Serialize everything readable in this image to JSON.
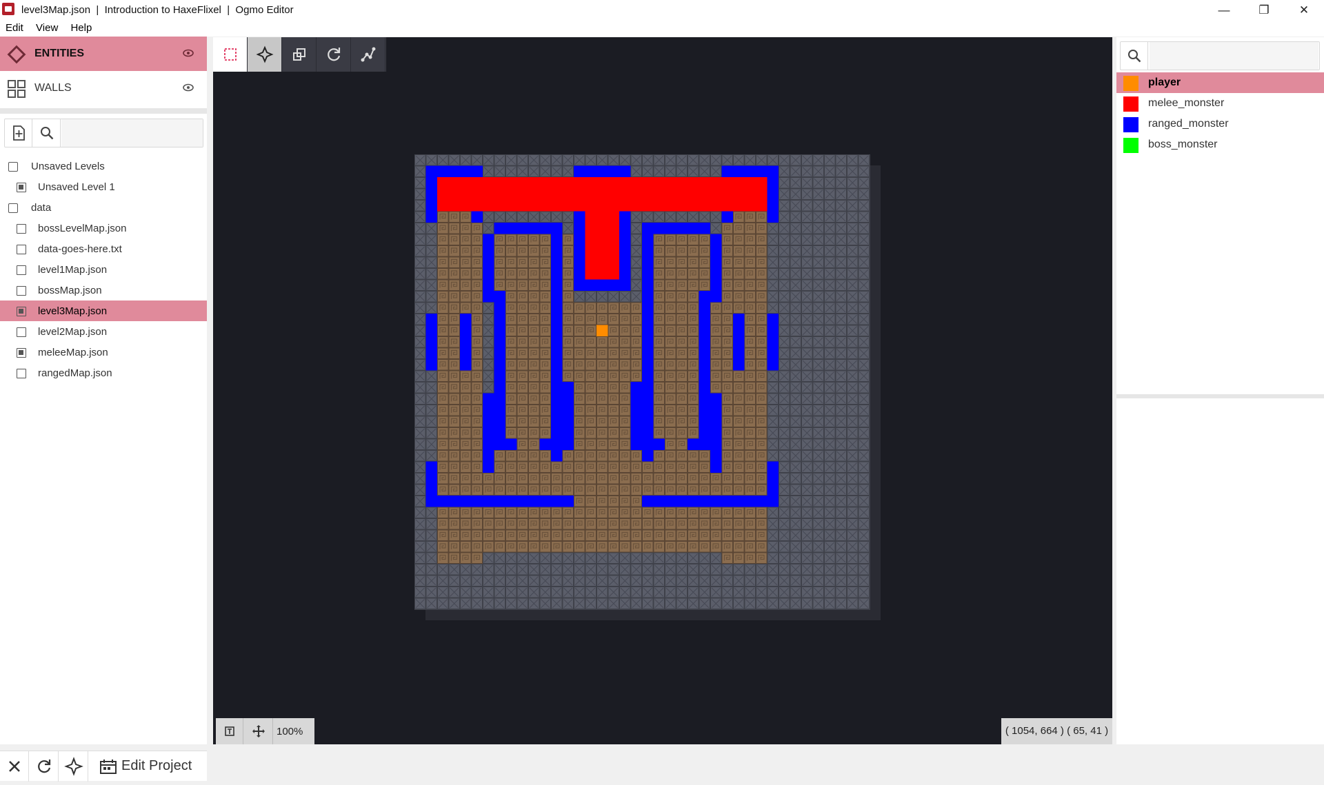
{
  "window": {
    "title": "level3Map.json  |  Introduction to HaxeFlixel  |  Ogmo Editor",
    "minimize": "—",
    "maximize": "❐",
    "close": "✕"
  },
  "menu": [
    "Edit",
    "View",
    "Help"
  ],
  "layers": [
    {
      "name": "ENTITIES",
      "icon": "diamond-icon",
      "selected": true
    },
    {
      "name": "WALLS",
      "icon": "grid-icon",
      "selected": false
    }
  ],
  "levels_tree": [
    {
      "label": "Unsaved Levels",
      "type": "folder"
    },
    {
      "label": "Unsaved Level 1",
      "type": "file",
      "dirty": true
    },
    {
      "label": "data",
      "type": "folder"
    },
    {
      "label": "bossLevelMap.json",
      "type": "file"
    },
    {
      "label": "data-goes-here.txt",
      "type": "file"
    },
    {
      "label": "level1Map.json",
      "type": "file"
    },
    {
      "label": "bossMap.json",
      "type": "file"
    },
    {
      "label": "level3Map.json",
      "type": "file",
      "dirty": true,
      "selected": true
    },
    {
      "label": "level2Map.json",
      "type": "file"
    },
    {
      "label": "meleeMap.json",
      "type": "file",
      "dirty": true
    },
    {
      "label": "rangedMap.json",
      "type": "file"
    }
  ],
  "bottom": {
    "edit_project": "Edit Project"
  },
  "canvas": {
    "zoom": "100%",
    "coords": "( 1054, 664 ) ( 65, 41 )"
  },
  "entities": [
    {
      "name": "player",
      "color": "#ff8c00",
      "selected": true
    },
    {
      "name": "melee_monster",
      "color": "#ff0000",
      "selected": false
    },
    {
      "name": "ranged_monster",
      "color": "#0000ff",
      "selected": false
    },
    {
      "name": "boss_monster",
      "color": "#00ff00",
      "selected": false
    }
  ],
  "colors": {
    "accent": "#e08a9b",
    "workspace_bg": "#1b1c23",
    "wall": "#5a5d68",
    "floor": "#8a6c4e",
    "player": "#ff8c00",
    "melee": "#ff0000",
    "ranged": "#0000ff"
  }
}
